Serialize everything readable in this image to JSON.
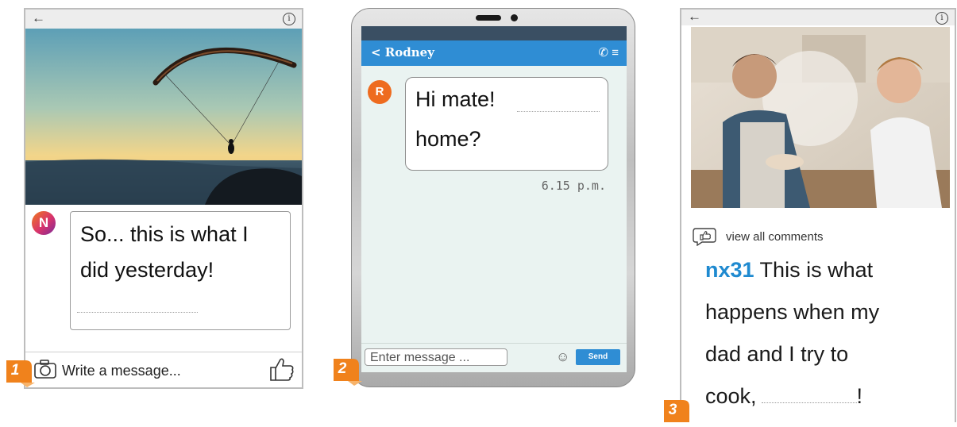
{
  "panel1": {
    "avatar_letter": "N",
    "message_line1": "So... this is what I",
    "message_line2": "did yesterday!",
    "input_placeholder": "Write a message...",
    "badge": "1"
  },
  "panel2": {
    "contact": "< Rodney",
    "bubble_line1": "Hi mate!",
    "bubble_line2": "home?",
    "avatar_letter": "R",
    "timestamp": "6.15 p.m.",
    "input_placeholder": "Enter message ...",
    "send_label": "Send",
    "badge": "2"
  },
  "panel3": {
    "view_comments": "view all comments",
    "username": "nx31",
    "comment_line1": " This is what",
    "comment_line2": "happens when my",
    "comment_line3": "dad and I try to",
    "comment_line4": "cook,",
    "comment_end": "!",
    "badge": "3"
  },
  "colors": {
    "accent_blue": "#2f8dd4",
    "badge_orange": "#f0821c",
    "avatar_r": "#ee6b1f",
    "username_blue": "#1f8ad0"
  },
  "icons": [
    "back-arrow-icon",
    "info-icon",
    "camera-icon",
    "thumbs-up-icon",
    "phone-icon",
    "menu-icon",
    "smiley-icon",
    "like-comment-icon"
  ]
}
